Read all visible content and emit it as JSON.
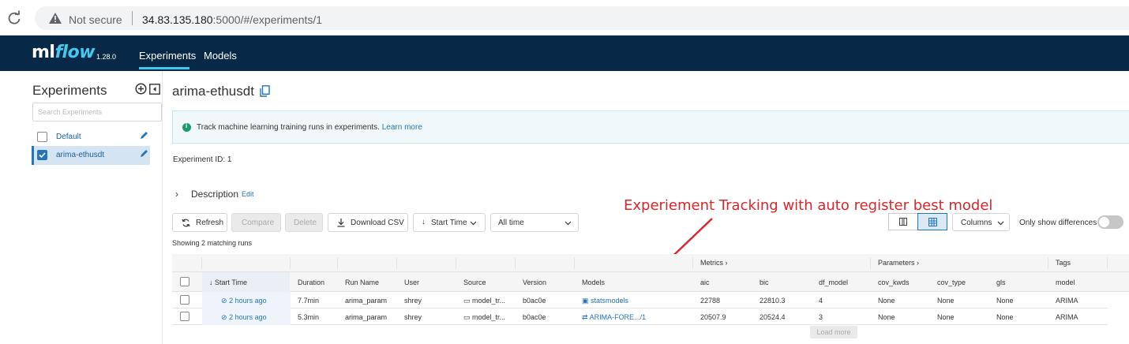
{
  "browser": {
    "security": "Not secure",
    "url_host": "34.83.135.180",
    "url_rest": ":5000/#/experiments/1"
  },
  "app": {
    "logo_ml": "ml",
    "logo_flow": "flow",
    "version": "1.28.0",
    "nav": [
      "Experiments",
      "Models"
    ]
  },
  "sidebar": {
    "title": "Experiments",
    "search_placeholder": "Search Experiments",
    "items": [
      {
        "label": "Default",
        "checked": false
      },
      {
        "label": "arima-ethusdt",
        "checked": true
      }
    ]
  },
  "main": {
    "title": "arima-ethusdt",
    "info_text": "Track machine learning training runs in experiments.",
    "info_link": "Learn more",
    "experiment_id": "Experiment ID:  1",
    "description": "Description",
    "description_edit": "Edit"
  },
  "toolbar": {
    "refresh": "Refresh",
    "compare": "Compare",
    "delete": "Delete",
    "download": "Download CSV",
    "sort": "Start Time",
    "time_filter": "All time",
    "columns": "Columns",
    "only_diff": "Only show differences",
    "showing": "Showing 2 matching runs"
  },
  "annotation": "Experiement Tracking with auto register best model",
  "table": {
    "groups": {
      "metrics": "Metrics",
      "parameters": "Parameters",
      "tags": "Tags"
    },
    "columns": [
      "Start Time",
      "Duration",
      "Run Name",
      "User",
      "Source",
      "Version",
      "Models",
      "aic",
      "bic",
      "df_model",
      "cov_kwds",
      "cov_type",
      "gls",
      "model"
    ],
    "rows": [
      [
        "2 hours ago",
        "7.7min",
        "arima_param",
        "shrey",
        "model_tr...",
        "b0ac0e",
        "statsmodels",
        "22788",
        "22810.3",
        "4",
        "None",
        "None",
        "None",
        "ARIMA"
      ],
      [
        "2 hours ago",
        "5.3min",
        "arima_param",
        "shrey",
        "model_tr...",
        "b0ac0e",
        "ARIMA-FORE.../1",
        "20507.9",
        "20524.4",
        "3",
        "None",
        "None",
        "None",
        "ARIMA"
      ]
    ],
    "load_more": "Load more"
  },
  "colors": {
    "header_bg": "#082848",
    "accent": "#43c9ed",
    "link": "#2374bb",
    "annotation": "#d9262b"
  }
}
